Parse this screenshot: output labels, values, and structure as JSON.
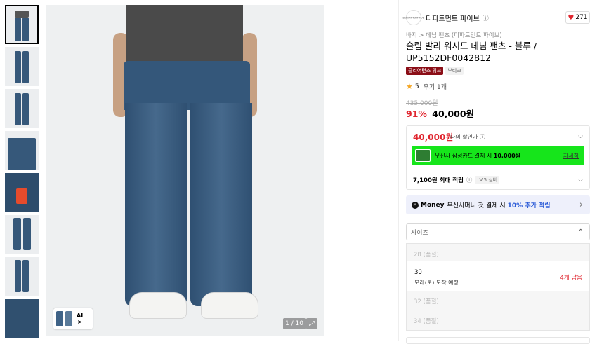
{
  "gallery": {
    "thumbnails": [
      "full",
      "full",
      "full",
      "detail",
      "label",
      "full",
      "full",
      "fabric"
    ],
    "counter": "1 / 10",
    "ai_chip_label": "AI",
    "ai_chip_arrow": ">",
    "expand_icon": "⤢"
  },
  "brand": {
    "logo_text": "DEPARTMENT FIVE",
    "name": "디파트먼트 파이브",
    "info_icon": "ⓘ",
    "like_count": "271"
  },
  "product": {
    "breadcrumb": "바지 > 데님 팬츠 (디파트먼트 파이브)",
    "title": "슬림 발리 워시드 데님 팬츠 - 블루 / UP5152DF0042812",
    "tags": [
      "클리어런스 위크",
      "부티크"
    ],
    "rating": "5",
    "review": "후기 1개",
    "original_price": "435,000원",
    "discount": "91%",
    "price": "40,000원"
  },
  "price_box": {
    "my_price": "40,000원",
    "my_price_label": "나의 할인가",
    "banner_text_pre": "무신사 삼성카드 결제 시 ",
    "banner_text_bold": "10,000원",
    "banner_more": "자세히",
    "points": "7,100원 최대 적립",
    "level": "LV.5 실버"
  },
  "money": {
    "icon": "M",
    "brand": "Money",
    "text_pre": "무신사머니 첫 결제 시",
    "highlight": "10% 추가 적립",
    "arrow": "›"
  },
  "size": {
    "placeholder": "사이즈",
    "options": [
      {
        "value": "28 (품절)",
        "disabled": true
      },
      {
        "value": "30",
        "delivery": "모레(토) 도착 예정",
        "stock": "4개 남음",
        "disabled": false
      },
      {
        "value": "32 (품절)",
        "disabled": true
      },
      {
        "value": "34 (품절)",
        "disabled": true
      }
    ]
  },
  "colors": {
    "accent_red": "#e0262f",
    "banner_green": "#16e51b",
    "money_blue": "#2b5bd7"
  }
}
